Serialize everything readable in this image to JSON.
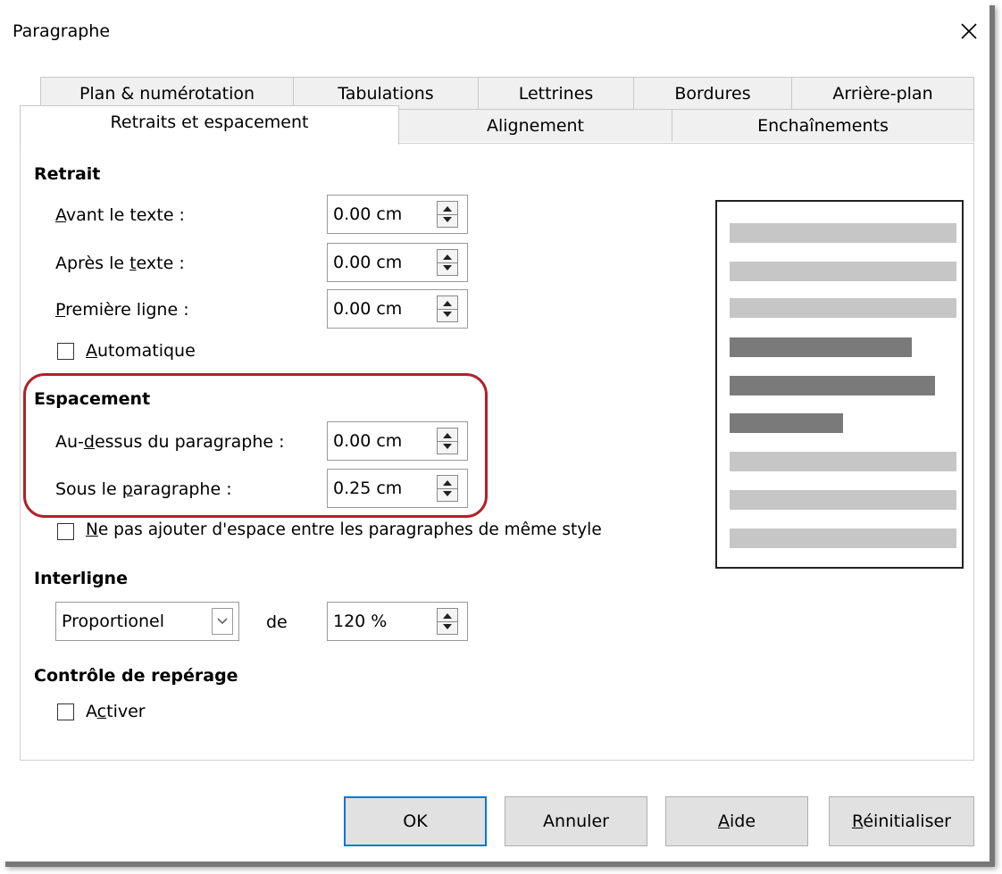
{
  "dialog": {
    "title": "Paragraphe"
  },
  "tabs_row1": [
    "Plan & numérotation",
    "Tabulations",
    "Lettrines",
    "Bordures",
    "Arrière-plan"
  ],
  "tabs_row2": [
    "Retraits et espacement",
    "Alignement",
    "Enchaînements"
  ],
  "active_tab": "Retraits et espacement",
  "retrait": {
    "heading": "Retrait",
    "avant_label_u": "A",
    "avant_label_rest": "vant le texte :",
    "avant_value": "0.00 cm",
    "apres_label_pre": "Après le ",
    "apres_label_u": "t",
    "apres_label_rest": "exte :",
    "apres_value": "0.00 cm",
    "premiere_label_u": "P",
    "premiere_label_rest": "remière ligne :",
    "premiere_value": "0.00 cm",
    "auto_u": "A",
    "auto_rest": "utomatique",
    "auto_checked": false
  },
  "espacement": {
    "heading": "Espacement",
    "dessus_pre": "Au-",
    "dessus_u": "d",
    "dessus_rest": "essus du paragraphe :",
    "dessus_value": "0.00 cm",
    "sous_pre": "Sous le ",
    "sous_u": "p",
    "sous_rest": "aragraphe :",
    "sous_value": "0.25 cm",
    "noadd_u": "N",
    "noadd_rest": "e pas ajouter d'espace entre les paragraphes de même style",
    "noadd_checked": false
  },
  "interligne": {
    "heading": "Interligne",
    "mode": "Proportionel",
    "de_label": "de",
    "value": "120 %"
  },
  "controle": {
    "heading": "Contrôle de repérage",
    "activer_pre": "A",
    "activer_u": "c",
    "activer_rest": "tiver",
    "activer_checked": false
  },
  "buttons": {
    "ok": "OK",
    "annuler": "Annuler",
    "aide_u": "A",
    "aide_rest": "ide",
    "reinit_u": "R",
    "reinit_rest": "éinitialiser"
  },
  "colors": {
    "highlight": "#b0212b",
    "preview_light": "#c6c6c6",
    "preview_dark": "#7a7a7a",
    "default_button_border": "#0078d7"
  }
}
